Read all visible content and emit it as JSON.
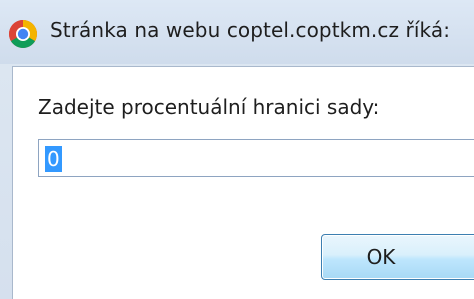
{
  "dialog": {
    "title": "Stránka na webu coptel.coptkm.cz říká:",
    "prompt": "Zadejte procentuální hranici sady:",
    "input_value": "0",
    "ok_label": "OK"
  },
  "icons": {
    "browser": "chrome-icon"
  }
}
